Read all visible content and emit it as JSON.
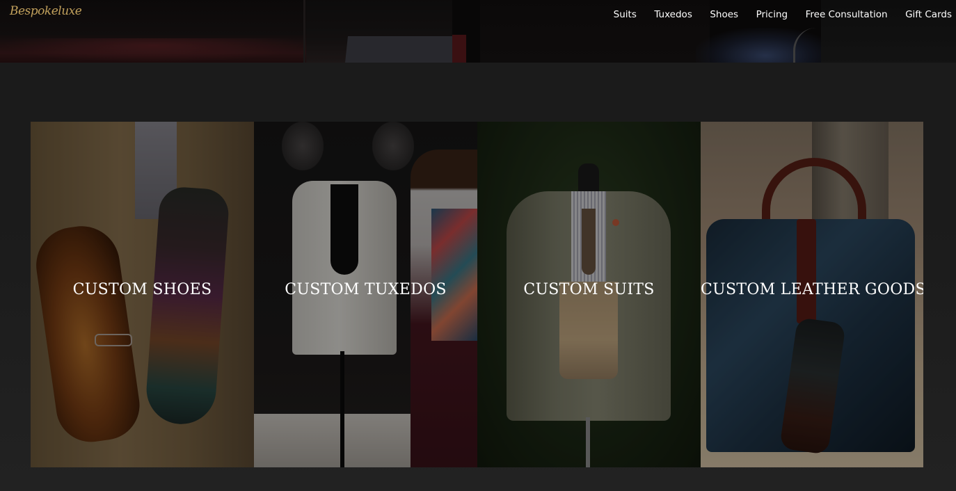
{
  "brand": {
    "logo_text": "Bespokeluxe"
  },
  "nav": {
    "items": [
      {
        "label": "Suits"
      },
      {
        "label": "Tuxedos"
      },
      {
        "label": "Shoes"
      },
      {
        "label": "Pricing"
      },
      {
        "label": "Free Consultation"
      },
      {
        "label": "Gift Cards"
      }
    ]
  },
  "tiles": [
    {
      "label": "CUSTOM SHOES"
    },
    {
      "label": "CUSTOM TUXEDOS"
    },
    {
      "label": "CUSTOM SUITS"
    },
    {
      "label": "CUSTOM LEATHER GOODS"
    }
  ],
  "colors": {
    "page_background": "#1f1f1f",
    "logo_gold": "#c2a15c",
    "nav_text": "#ffffff",
    "tile_label": "#ffffff"
  }
}
